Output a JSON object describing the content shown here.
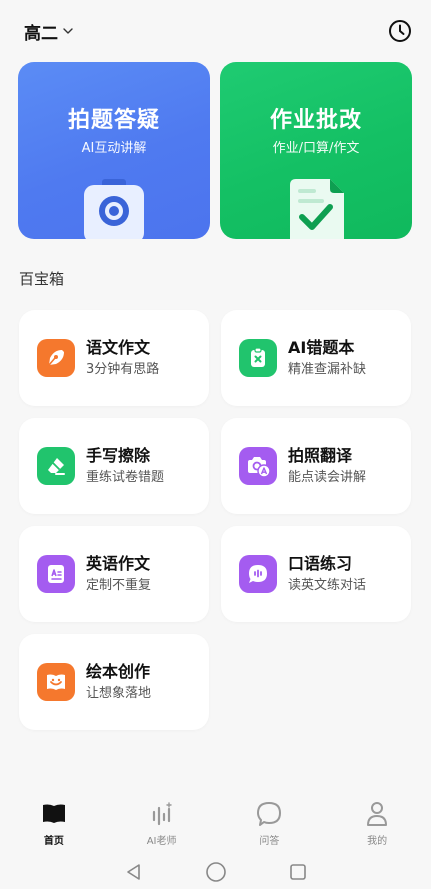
{
  "header": {
    "grade": "高二"
  },
  "hero": [
    {
      "title": "拍题答疑",
      "sub": "AI互动讲解"
    },
    {
      "title": "作业批改",
      "sub": "作业/口算/作文"
    }
  ],
  "section_title": "百宝箱",
  "tools": [
    {
      "name": "语文作文",
      "desc": "3分钟有思路",
      "color": "#f5782d",
      "icon": "pen-nib-icon"
    },
    {
      "name": "AI错题本",
      "desc": "精准查漏补缺",
      "color": "#21c46d",
      "icon": "error-book-icon"
    },
    {
      "name": "手写擦除",
      "desc": "重练试卷错题",
      "color": "#21c46d",
      "icon": "eraser-icon"
    },
    {
      "name": "拍照翻译",
      "desc": "能点读会讲解",
      "color": "#a45cf0",
      "icon": "camera-translate-icon"
    },
    {
      "name": "英语作文",
      "desc": "定制不重复",
      "color": "#a45cf0",
      "icon": "english-doc-icon"
    },
    {
      "name": "口语练习",
      "desc": "读英文练对话",
      "color": "#a45cf0",
      "icon": "speech-icon"
    },
    {
      "name": "绘本创作",
      "desc": "让想象落地",
      "color": "#f5782d",
      "icon": "picture-book-icon"
    }
  ],
  "nav": [
    {
      "label": "首页",
      "icon": "book-icon",
      "active": true
    },
    {
      "label": "AI老师",
      "icon": "ai-teacher-icon",
      "active": false
    },
    {
      "label": "问答",
      "icon": "chat-bubble-icon",
      "active": false
    },
    {
      "label": "我的",
      "icon": "person-icon",
      "active": false
    }
  ],
  "system_bar": [
    "back-icon",
    "home-icon",
    "recents-icon"
  ]
}
